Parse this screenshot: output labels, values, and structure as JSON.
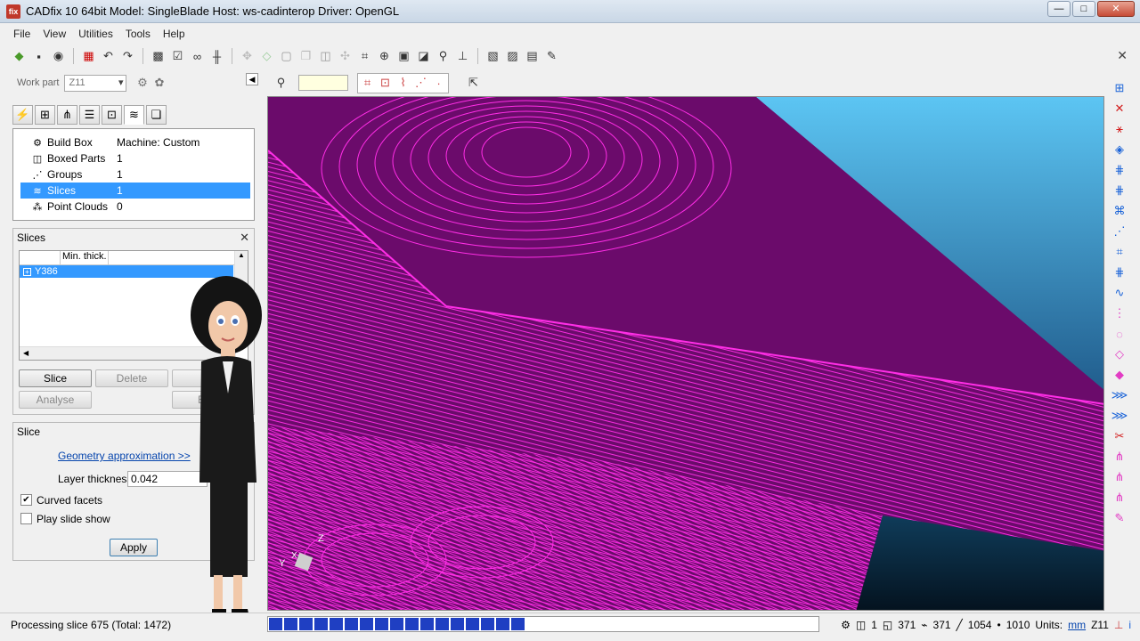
{
  "window": {
    "title": "CADfix 10 64bit   Model: SingleBlade   Host: ws-cadinterop   Driver: OpenGL",
    "minimize": "—",
    "restore": "□",
    "close": "✕"
  },
  "menu": [
    "File",
    "View",
    "Utilities",
    "Tools",
    "Help"
  ],
  "workpart": {
    "label": "Work part",
    "value": "Z11"
  },
  "tree": {
    "rows": [
      {
        "label": "Build Box",
        "value": "Machine: Custom",
        "icon": "gear-icon"
      },
      {
        "label": "Boxed Parts",
        "value": "1",
        "icon": "cube-icon"
      },
      {
        "label": "Groups",
        "value": "1",
        "icon": "groups-icon"
      },
      {
        "label": "Slices",
        "value": "1",
        "icon": "layers-icon"
      },
      {
        "label": "Point Clouds",
        "value": "0",
        "icon": "points-icon"
      }
    ]
  },
  "slices_panel": {
    "title": "Slices",
    "column_min_thick": "Min. thick.",
    "row_label": "Y386",
    "buttons": {
      "slice": "Slice",
      "delete": "Delete",
      "analyse": "Analyse",
      "export": "Exp"
    }
  },
  "slice_panel": {
    "title": "Slice",
    "geometry_link": "Geometry approximation >>",
    "layer_thickness_label": "Layer thickness",
    "layer_thickness_value": "0.042",
    "curved_facets_label": "Curved facets",
    "curved_facets_checked": true,
    "play_slide_show_label": "Play slide show",
    "play_slide_show_checked": false,
    "apply": "Apply"
  },
  "status": {
    "message": "Processing slice 675 (Total: 1472)",
    "progress_fraction": 0.459,
    "count1": "1",
    "count2": "371",
    "count3": "371",
    "count4": "1054",
    "count5": "1010",
    "units_label": "Units:",
    "units_value": "mm",
    "workpart": "Z11",
    "info": "i"
  },
  "axes": {
    "x": "X",
    "y": "Y",
    "z": "Z"
  },
  "colors": {
    "viewport_bg": "#6b0b6b",
    "slice_lines": "#ff2ee6",
    "sky": "#4fb4e6",
    "selection": "#3399ff"
  }
}
